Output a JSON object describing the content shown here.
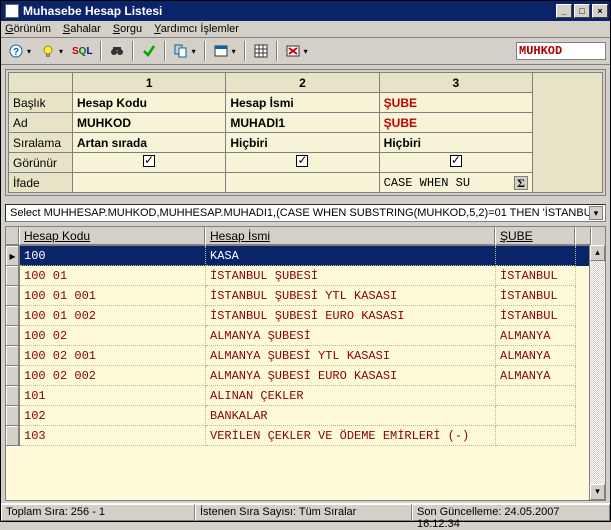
{
  "window": {
    "title": "Muhasebe Hesap Listesi"
  },
  "menu": {
    "items": [
      "Görünüm",
      "Sahalar",
      "Sorgu",
      "Yardımcı İşlemler"
    ]
  },
  "toolbar": {
    "sql_label": "SQL",
    "search_value": "MUHKOD"
  },
  "config": {
    "col_headers": [
      "1",
      "2",
      "3"
    ],
    "rows": {
      "baslik": {
        "label": "Başlık",
        "v": [
          "Hesap Kodu",
          "Hesap İsmi",
          "ŞUBE"
        ]
      },
      "ad": {
        "label": "Ad",
        "v": [
          "MUHKOD",
          "MUHADI1",
          "ŞUBE"
        ]
      },
      "siralama": {
        "label": "Sıralama",
        "v": [
          "Artan sırada",
          "Hiçbiri",
          "Hiçbiri"
        ]
      },
      "gorunur": {
        "label": "Görünür"
      },
      "ifade": {
        "label": "İfade",
        "v3": "CASE WHEN SU"
      }
    }
  },
  "sql": "Select MUHHESAP.MUHKOD,MUHHESAP.MUHADI1,(CASE WHEN SUBSTRING(MUHKOD,5,2)=01 THEN 'İSTANBUL'",
  "result": {
    "headers": [
      "Hesap Kodu",
      "Hesap İsmi",
      "ŞUBE"
    ],
    "rows": [
      {
        "k": "100",
        "n": "KASA",
        "s": ""
      },
      {
        "k": "100 01",
        "n": "İSTANBUL ŞUBESİ",
        "s": "İSTANBUL"
      },
      {
        "k": "100 01 001",
        "n": "İSTANBUL ŞUBESİ YTL KASASI",
        "s": "İSTANBUL"
      },
      {
        "k": "100 01 002",
        "n": "İSTANBUL ŞUBESİ EURO KASASI",
        "s": "İSTANBUL"
      },
      {
        "k": "100 02",
        "n": "ALMANYA ŞUBESİ",
        "s": "ALMANYA"
      },
      {
        "k": "100 02 001",
        "n": "ALMANYA ŞUBESİ YTL KASASI",
        "s": "ALMANYA"
      },
      {
        "k": "100 02 002",
        "n": "ALMANYA ŞUBESİ EURO KASASI",
        "s": "ALMANYA"
      },
      {
        "k": "101",
        "n": "ALINAN ÇEKLER",
        "s": ""
      },
      {
        "k": "102",
        "n": "BANKALAR",
        "s": ""
      },
      {
        "k": "103",
        "n": "VERİLEN ÇEKLER VE ÖDEME EMİRLERİ (-)",
        "s": ""
      }
    ]
  },
  "status": {
    "left": "Toplam Sıra: 256 - 1",
    "mid": "İstenen Sıra Sayısı: Tüm Sıralar",
    "right": "Son Güncelleme: 24.05.2007 16:12:34"
  }
}
